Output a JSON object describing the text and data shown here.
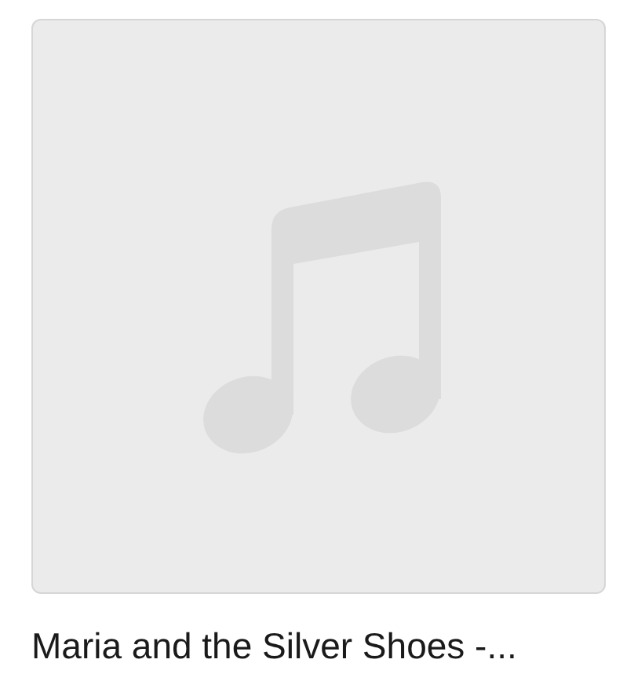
{
  "album": {
    "title": "Maria and the Silver Shoes -..."
  }
}
